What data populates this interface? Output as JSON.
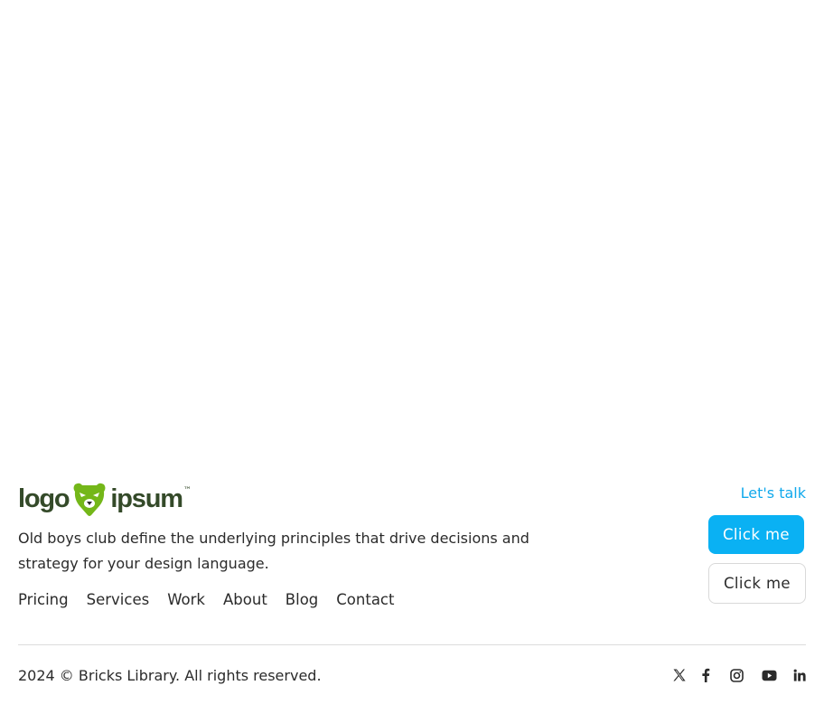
{
  "brand": {
    "logo_left": "logo",
    "logo_right": "ipsum",
    "logo_mark": "™",
    "primary_color": "#344a29",
    "bear_color": "#74b719"
  },
  "footer": {
    "description": "Old boys club define the underlying principles that drive decisions and strategy for your design language.",
    "nav": [
      "Pricing",
      "Services",
      "Work",
      "About",
      "Blog",
      "Contact"
    ],
    "lets_talk": "Let's talk",
    "buttons": {
      "primary_label": "Click me",
      "secondary_label": "Click me"
    },
    "copyright": "2024 © Bricks Library. All rights reserved.",
    "social": [
      "x-icon",
      "facebook-icon",
      "instagram-icon",
      "youtube-icon",
      "linkedin-icon"
    ]
  },
  "colors": {
    "accent": "#0ab1f3",
    "link": "#11a9ec",
    "text": "#2b2b2b",
    "divider": "#dcdcdc"
  }
}
